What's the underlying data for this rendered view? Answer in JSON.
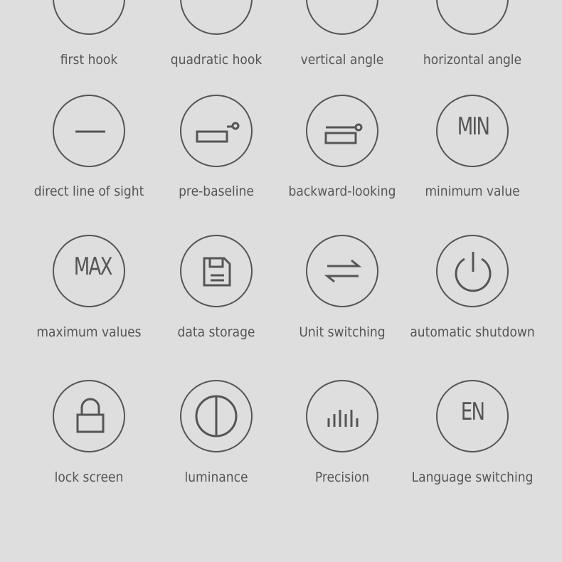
{
  "items": [
    {
      "label": "first hook",
      "icon": "first-hook-icon"
    },
    {
      "label": "quadratic hook",
      "icon": "quadratic-hook-icon"
    },
    {
      "label": "vertical angle",
      "icon": "vertical-angle-icon"
    },
    {
      "label": "horizontal angle",
      "icon": "horizontal-angle-icon"
    },
    {
      "label": "direct line of sight",
      "icon": "line-icon"
    },
    {
      "label": "pre-baseline",
      "icon": "pre-baseline-icon"
    },
    {
      "label": "backward-looking",
      "icon": "backward-looking-icon"
    },
    {
      "label": "minimum value",
      "icon": "min-icon",
      "text": "MIN"
    },
    {
      "label": "maximum values",
      "icon": "max-icon",
      "text": "MAX"
    },
    {
      "label": "data storage",
      "icon": "floppy-disk-icon"
    },
    {
      "label": "Unit switching",
      "icon": "swap-arrows-icon"
    },
    {
      "label": "automatic shutdown",
      "icon": "power-icon"
    },
    {
      "label": "lock screen",
      "icon": "lock-icon"
    },
    {
      "label": "luminance",
      "icon": "brightness-icon"
    },
    {
      "label": "Precision",
      "icon": "bars-icon"
    },
    {
      "label": "Language switching",
      "icon": "language-icon",
      "text": "EN"
    }
  ]
}
